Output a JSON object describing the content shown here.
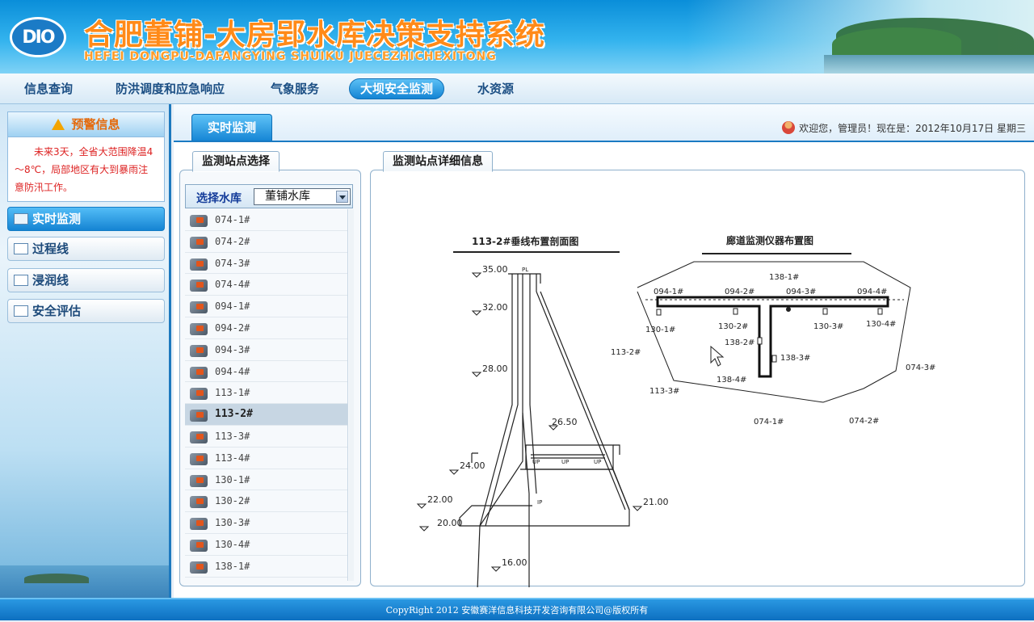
{
  "header": {
    "logo_text": "DIO",
    "title": "合肥董铺-大房郢水库决策支持系统",
    "subtitle": "HEFEI DONGPU-DAFANGYING SHUIKU JUECEZHICHEXITONG"
  },
  "nav": {
    "items": [
      "信息查询",
      "防洪调度和应急响应",
      "气象服务",
      "大坝安全监测",
      "水资源"
    ],
    "active_index": 3
  },
  "sidebar": {
    "warning_title": "预警信息",
    "warning_text": "未来3天，全省大范围降温4～8℃，局部地区有大到暴雨注意防汛工作。",
    "menu": [
      "实时监测",
      "过程线",
      "浸润线",
      "安全评估"
    ],
    "active_menu_index": 0
  },
  "content": {
    "tab_label": "实时监测",
    "welcome": "欢迎您，管理员！现在是：2012年10月17日 星期三",
    "station_panel_title": "监测站点选择",
    "detail_panel_title": "监测站点详细信息",
    "reservoir_label": "选择水库",
    "reservoir_selected": "董铺水库",
    "stations": [
      "074-1#",
      "074-2#",
      "074-3#",
      "074-4#",
      "094-1#",
      "094-2#",
      "094-3#",
      "094-4#",
      "113-1#",
      "113-2#",
      "113-3#",
      "113-4#",
      "130-1#",
      "130-2#",
      "130-3#",
      "130-4#",
      "138-1#"
    ],
    "selected_station": "113-2#"
  },
  "diagram": {
    "section_title": "113-2#垂线布置剖面图",
    "gallery_title": "廊道监测仪器布置图",
    "elevations": [
      "35.00",
      "32.00",
      "28.00",
      "26.50",
      "24.00",
      "22.00",
      "21.00",
      "20.00",
      "16.00"
    ],
    "section_labels": [
      "PL",
      "UP",
      "UP",
      "UP",
      "IP"
    ],
    "gallery_labels": [
      "094-1#",
      "094-2#",
      "094-3#",
      "094-4#",
      "130-1#",
      "130-2#",
      "130-3#",
      "130-4#",
      "138-1#",
      "138-2#",
      "138-3#",
      "138-4#",
      "113-2#",
      "113-3#",
      "074-1#",
      "074-2#",
      "074-3#"
    ]
  },
  "footer": {
    "copyright": "CopyRight 2012 安徽赛洋信息科技开发咨询有限公司@版权所有"
  },
  "colors": {
    "brand_blue": "#1584d3",
    "title_orange": "#ff8a18",
    "warning_red": "#dd2222"
  }
}
